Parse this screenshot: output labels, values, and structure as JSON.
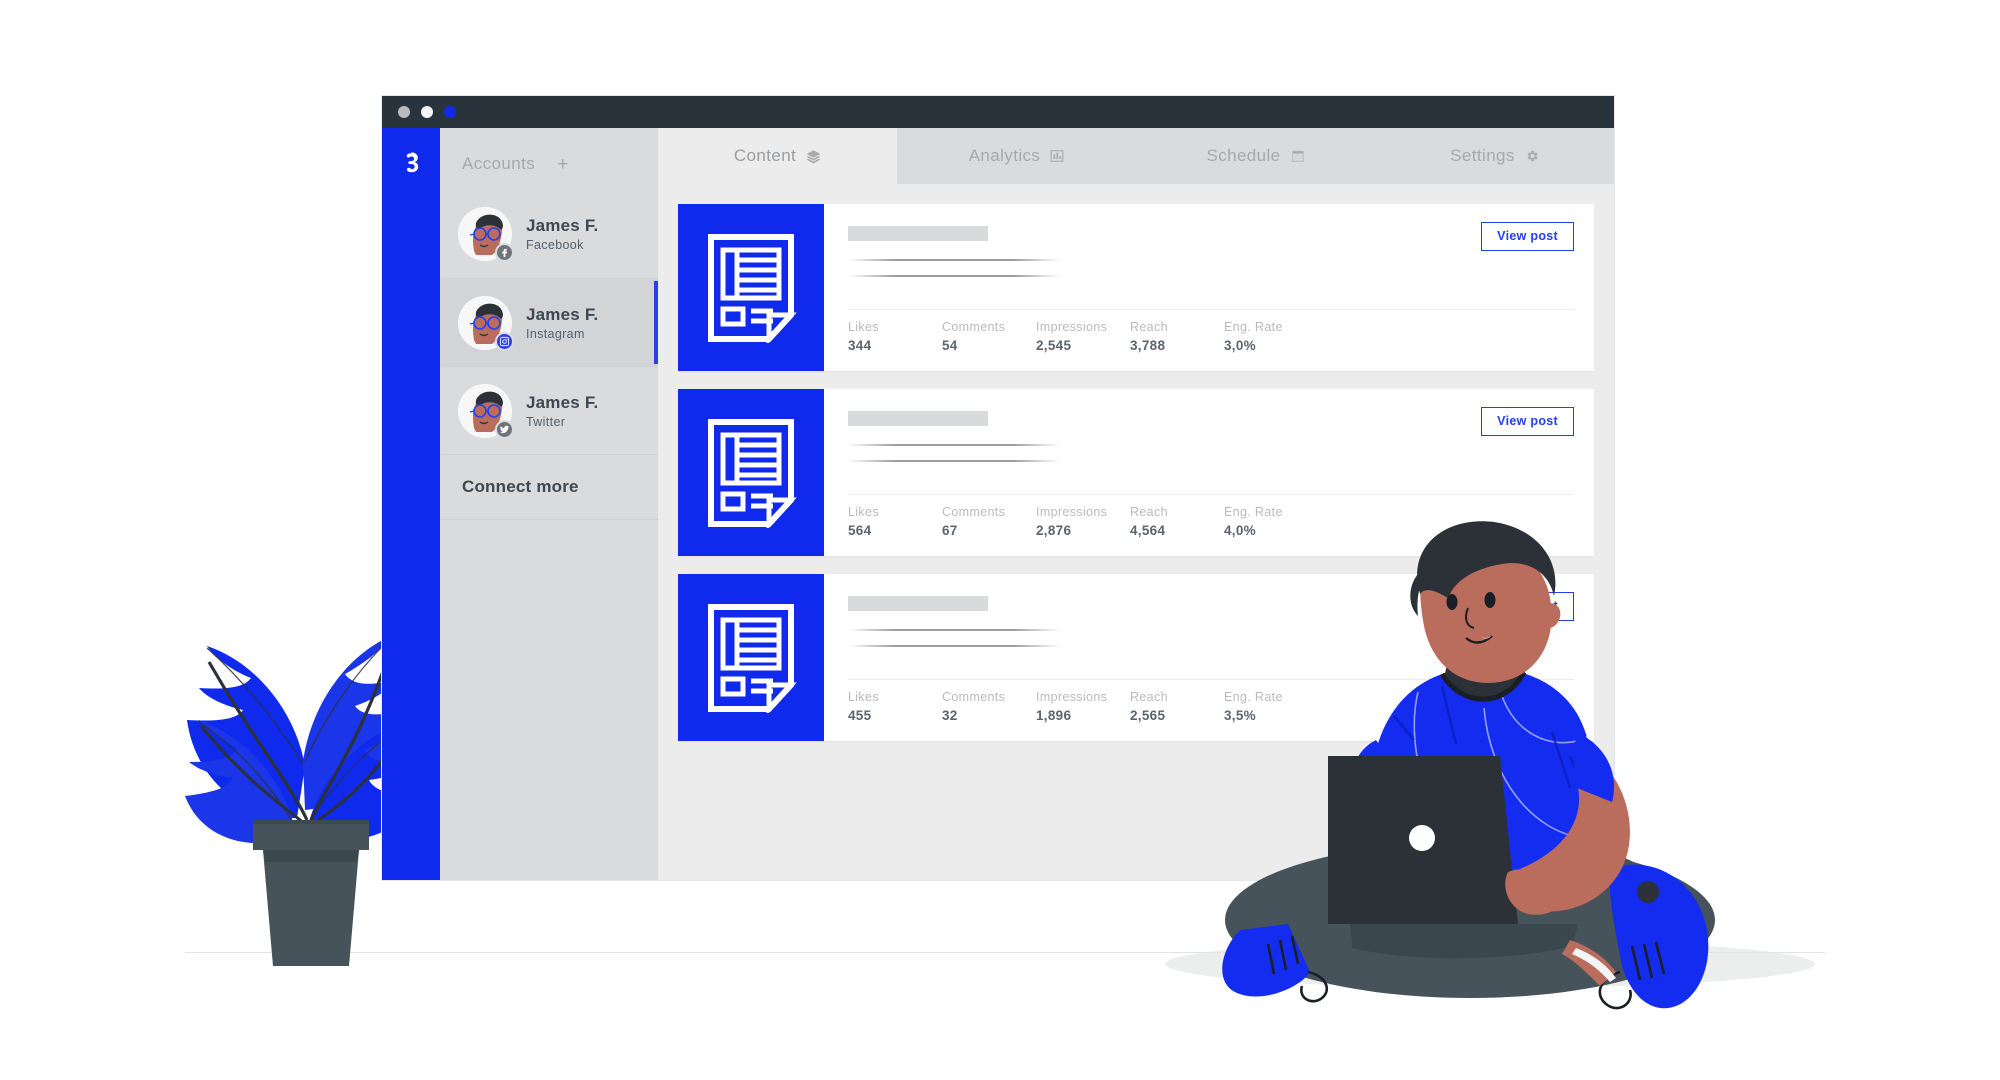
{
  "window": {
    "traffic_lights": [
      "grey",
      "white",
      "blue"
    ],
    "brand_logo": "buffer-logo"
  },
  "sidebar": {
    "header": {
      "title": "Accounts",
      "add_label": "+"
    },
    "accounts": [
      {
        "name": "James F.",
        "network": "Facebook",
        "badge": "facebook-icon",
        "active": false
      },
      {
        "name": "James F.",
        "network": "Instagram",
        "badge": "instagram-icon",
        "active": true
      },
      {
        "name": "James F.",
        "network": "Twitter",
        "badge": "twitter-icon",
        "active": false
      }
    ],
    "connect_more": "Connect more"
  },
  "tabs": [
    {
      "label": "Content",
      "icon": "layers-icon",
      "active": true
    },
    {
      "label": "Analytics",
      "icon": "bar-chart-icon",
      "active": false
    },
    {
      "label": "Schedule",
      "icon": "calendar-icon",
      "active": false
    },
    {
      "label": "Settings",
      "icon": "gear-icon",
      "active": false
    }
  ],
  "metric_labels": [
    "Likes",
    "Comments",
    "Impressions",
    "Reach",
    "Eng. Rate"
  ],
  "posts": [
    {
      "thumbnail": "document-icon",
      "view_label": "View post",
      "metrics": {
        "likes": "344",
        "comments": "54",
        "impressions": "2,545",
        "reach": "3,788",
        "eng_rate": "3,0%"
      }
    },
    {
      "thumbnail": "document-icon",
      "view_label": "View post",
      "metrics": {
        "likes": "564",
        "comments": "67",
        "impressions": "2,876",
        "reach": "4,564",
        "eng_rate": "4,0%"
      }
    },
    {
      "thumbnail": "document-icon",
      "view_label": "View post",
      "metrics": {
        "likes": "455",
        "comments": "32",
        "impressions": "1,896",
        "reach": "2,565",
        "eng_rate": "3,5%"
      }
    }
  ],
  "colors": {
    "brand_blue": "#0f2aed",
    "accent_blue": "#2440ef",
    "titlebar": "#28333c",
    "sidebar_bg": "#dadbdc",
    "panel_bg": "#ececec",
    "card_bg": "#ffffff",
    "muted_text": "#a6a8aa",
    "dark_text": "#3c4853",
    "skin": "#ba6c5d",
    "hair": "#2b3137",
    "pot": "#46535a"
  }
}
